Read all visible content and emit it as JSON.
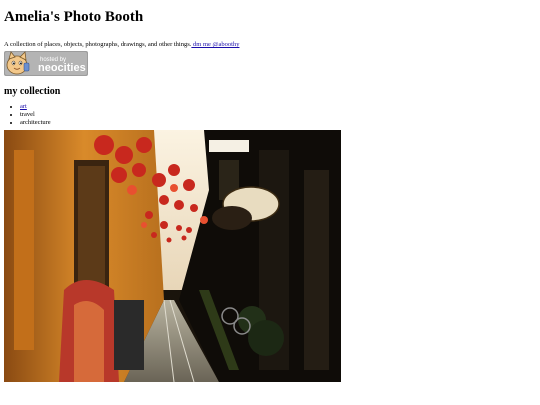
{
  "site": {
    "title": "Amelia's Photo Booth",
    "intro_text": "A collection of places, objects, photographs, drawings, and other things.",
    "dm_link": " dm me @aboothy ",
    "badge": {
      "line1": "hosted by",
      "line2": "neocities",
      "icon": "neocities-cat-logo"
    }
  },
  "collection": {
    "heading": "my collection",
    "items": [
      {
        "label": "art",
        "is_link": true
      },
      {
        "label": "travel",
        "is_link": false
      },
      {
        "label": "architecture",
        "is_link": false
      }
    ]
  },
  "photo": {
    "subject": "alley-with-red-lanterns",
    "colors": {
      "lanterns": "#c8281e",
      "walls": "#d98a2a",
      "sky": "#f4e9d6"
    }
  }
}
